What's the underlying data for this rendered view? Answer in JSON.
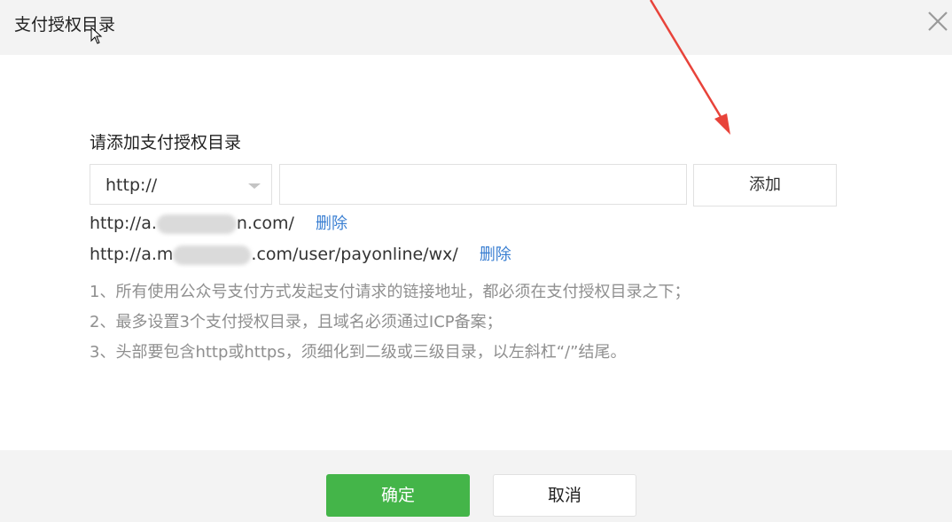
{
  "dialog": {
    "title": "支付授权目录",
    "close_icon": "close-icon"
  },
  "form": {
    "label": "请添加支付授权目录",
    "protocol_select": {
      "value": "http://"
    },
    "path_input": {
      "value": "",
      "placeholder": ""
    },
    "add_button": "添加"
  },
  "entries": [
    {
      "prefix": "http://a.",
      "suffix": "n.com/",
      "delete_label": "删除"
    },
    {
      "prefix": "http://a.m",
      "suffix": ".com/user/payonline/wx/",
      "delete_label": "删除"
    }
  ],
  "notes": [
    "1、所有使用公众号支付方式发起支付请求的链接地址，都必须在支付授权目录之下；",
    "2、最多设置3个支付授权目录，且域名必须通过ICP备案；",
    "3、头部要包含http或https，须细化到二级或三级目录，以左斜杠“/”结尾。"
  ],
  "footer": {
    "confirm_button": "确定",
    "cancel_button": "取消"
  },
  "colors": {
    "primary_green": "#44b549",
    "link_blue": "#3a7fd2",
    "annotation_red": "#e8433a"
  }
}
